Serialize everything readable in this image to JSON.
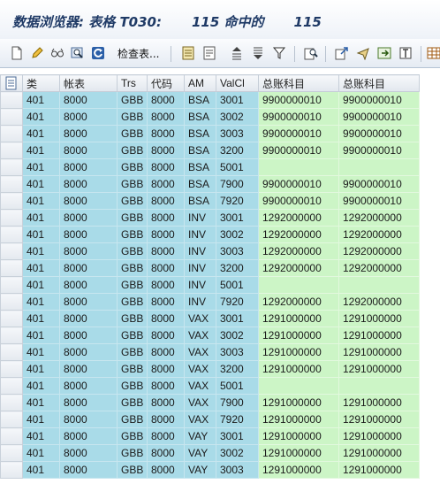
{
  "window": {
    "title_parts": [
      "数据浏览器: 表格 T030:",
      "115 命中的",
      "115"
    ]
  },
  "toolbar": {
    "check_table_label": "检查表..."
  },
  "table": {
    "columns": [
      "类",
      "帐表",
      "Trs",
      "代码",
      "AM",
      "ValCl",
      "总账科目",
      "总账科目"
    ],
    "rows": [
      [
        "401",
        "8000",
        "GBB",
        "8000",
        "BSA",
        "3001",
        "9900000010",
        "9900000010"
      ],
      [
        "401",
        "8000",
        "GBB",
        "8000",
        "BSA",
        "3002",
        "9900000010",
        "9900000010"
      ],
      [
        "401",
        "8000",
        "GBB",
        "8000",
        "BSA",
        "3003",
        "9900000010",
        "9900000010"
      ],
      [
        "401",
        "8000",
        "GBB",
        "8000",
        "BSA",
        "3200",
        "9900000010",
        "9900000010"
      ],
      [
        "401",
        "8000",
        "GBB",
        "8000",
        "BSA",
        "5001",
        "",
        ""
      ],
      [
        "401",
        "8000",
        "GBB",
        "8000",
        "BSA",
        "7900",
        "9900000010",
        "9900000010"
      ],
      [
        "401",
        "8000",
        "GBB",
        "8000",
        "BSA",
        "7920",
        "9900000010",
        "9900000010"
      ],
      [
        "401",
        "8000",
        "GBB",
        "8000",
        "INV",
        "3001",
        "1292000000",
        "1292000000"
      ],
      [
        "401",
        "8000",
        "GBB",
        "8000",
        "INV",
        "3002",
        "1292000000",
        "1292000000"
      ],
      [
        "401",
        "8000",
        "GBB",
        "8000",
        "INV",
        "3003",
        "1292000000",
        "1292000000"
      ],
      [
        "401",
        "8000",
        "GBB",
        "8000",
        "INV",
        "3200",
        "1292000000",
        "1292000000"
      ],
      [
        "401",
        "8000",
        "GBB",
        "8000",
        "INV",
        "5001",
        "",
        ""
      ],
      [
        "401",
        "8000",
        "GBB",
        "8000",
        "INV",
        "7920",
        "1292000000",
        "1292000000"
      ],
      [
        "401",
        "8000",
        "GBB",
        "8000",
        "VAX",
        "3001",
        "1291000000",
        "1291000000"
      ],
      [
        "401",
        "8000",
        "GBB",
        "8000",
        "VAX",
        "3002",
        "1291000000",
        "1291000000"
      ],
      [
        "401",
        "8000",
        "GBB",
        "8000",
        "VAX",
        "3003",
        "1291000000",
        "1291000000"
      ],
      [
        "401",
        "8000",
        "GBB",
        "8000",
        "VAX",
        "3200",
        "1291000000",
        "1291000000"
      ],
      [
        "401",
        "8000",
        "GBB",
        "8000",
        "VAX",
        "5001",
        "",
        ""
      ],
      [
        "401",
        "8000",
        "GBB",
        "8000",
        "VAX",
        "7900",
        "1291000000",
        "1291000000"
      ],
      [
        "401",
        "8000",
        "GBB",
        "8000",
        "VAX",
        "7920",
        "1291000000",
        "1291000000"
      ],
      [
        "401",
        "8000",
        "GBB",
        "8000",
        "VAY",
        "3001",
        "1291000000",
        "1291000000"
      ],
      [
        "401",
        "8000",
        "GBB",
        "8000",
        "VAY",
        "3002",
        "1291000000",
        "1291000000"
      ],
      [
        "401",
        "8000",
        "GBB",
        "8000",
        "VAY",
        "3003",
        "1291000000",
        "1291000000"
      ]
    ]
  },
  "colors": {
    "key_bg": "#a9dbe8",
    "value_bg": "#ccf5c6",
    "title_color": "#1f3a66"
  }
}
